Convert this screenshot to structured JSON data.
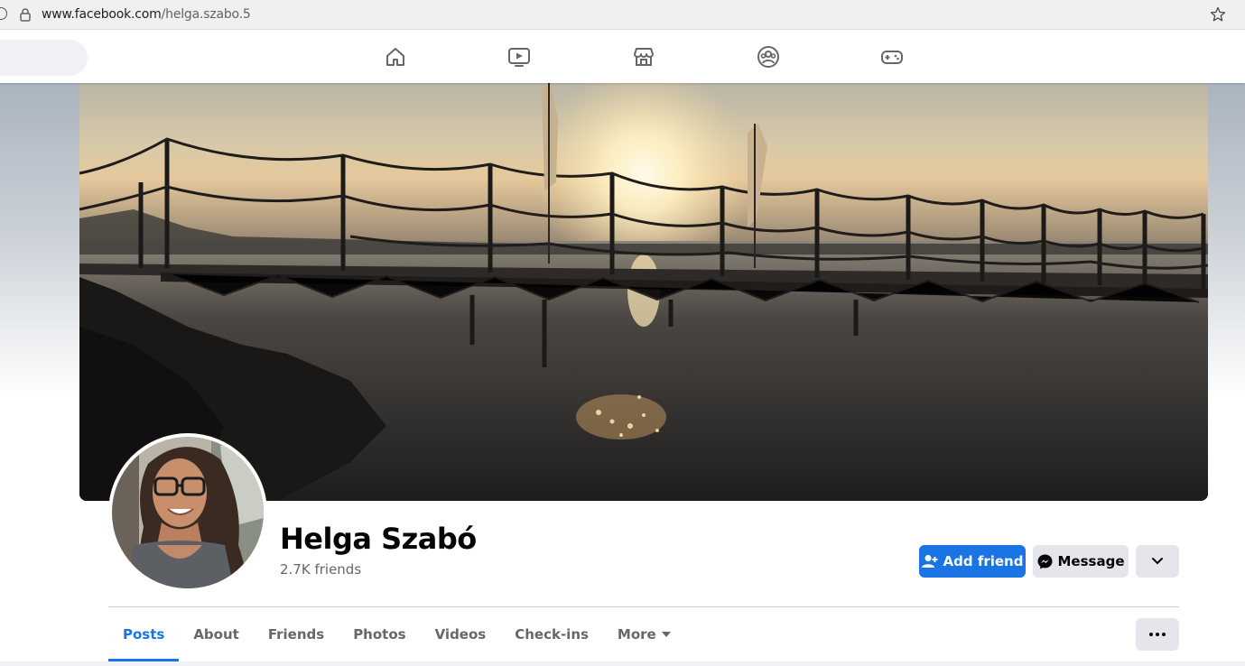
{
  "browser": {
    "url_domain": "www.facebook.com",
    "url_path": "/helga.szabo.5"
  },
  "nav": {
    "icons": [
      "home-icon",
      "watch-icon",
      "marketplace-icon",
      "groups-icon",
      "gaming-icon"
    ]
  },
  "profile": {
    "name": "Helga Szabó",
    "friends": "2.7K friends"
  },
  "actions": {
    "add_friend": "Add friend",
    "message": "Message"
  },
  "tabs": [
    {
      "label": "Posts",
      "active": true
    },
    {
      "label": "About"
    },
    {
      "label": "Friends"
    },
    {
      "label": "Photos"
    },
    {
      "label": "Videos"
    },
    {
      "label": "Check-ins"
    },
    {
      "label": "More"
    }
  ],
  "colors": {
    "accent": "#1b74e4",
    "secondary_button": "#e4e6eb",
    "muted_text": "#65676b"
  }
}
